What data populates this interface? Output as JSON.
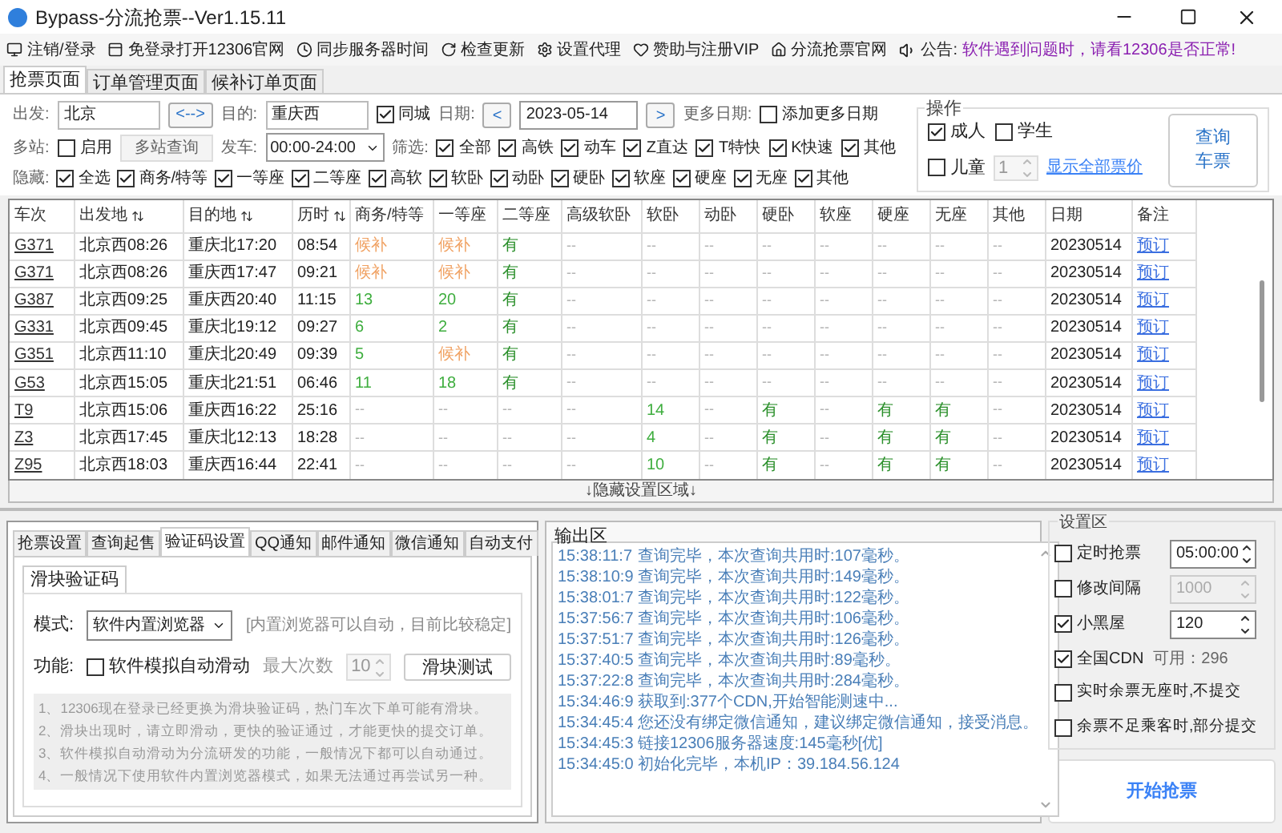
{
  "window": {
    "title": "Bypass-分流抢票--Ver1.15.11"
  },
  "toolbar": {
    "items": [
      "注销/登录",
      "免登录打开12306官网",
      "同步服务器时间",
      "检查更新",
      "设置代理",
      "赞助与注册VIP",
      "分流抢票官网"
    ],
    "notice_label": "公告:",
    "notice": "软件遇到问题时，请看12306是否正常!"
  },
  "tabs": [
    {
      "label": "抢票页面",
      "selected": true
    },
    {
      "label": "订单管理页面",
      "selected": false
    },
    {
      "label": "候补订单页面",
      "selected": false
    }
  ],
  "search": {
    "from_label": "出发:",
    "from": "北京",
    "swap": "<-->",
    "to_label": "目的:",
    "to": "重庆西",
    "same_city": {
      "label": "同城",
      "checked": true
    },
    "date_label": "日期:",
    "prev": "<",
    "date": "2023-05-14",
    "next": ">",
    "more_dates_label": "更多日期:",
    "add_more": {
      "label": "添加更多日期",
      "checked": false
    },
    "multi_label": "多站:",
    "multi_enable": {
      "label": "启用",
      "checked": false
    },
    "multi_button": "多站查询",
    "depart_label": "发车:",
    "depart": "00:00-24:00",
    "filter_label": "筛选:",
    "filters": [
      {
        "label": "全部",
        "checked": true
      },
      {
        "label": "高铁",
        "checked": true
      },
      {
        "label": "动车",
        "checked": true
      },
      {
        "label": "Z直达",
        "checked": true
      },
      {
        "label": "T特快",
        "checked": true
      },
      {
        "label": "K快速",
        "checked": true
      },
      {
        "label": "其他",
        "checked": true
      }
    ],
    "hide_label": "隐藏:",
    "hides": [
      {
        "label": "全选",
        "checked": true
      },
      {
        "label": "商务/特等",
        "checked": true
      },
      {
        "label": "一等座",
        "checked": true
      },
      {
        "label": "二等座",
        "checked": true
      },
      {
        "label": "高软",
        "checked": true
      },
      {
        "label": "软卧",
        "checked": true
      },
      {
        "label": "动卧",
        "checked": true
      },
      {
        "label": "硬卧",
        "checked": true
      },
      {
        "label": "软座",
        "checked": true
      },
      {
        "label": "硬座",
        "checked": true
      },
      {
        "label": "无座",
        "checked": true
      },
      {
        "label": "其他",
        "checked": true
      }
    ]
  },
  "operations": {
    "title": "操作",
    "passengers": [
      {
        "label": "成人",
        "checked": true
      },
      {
        "label": "学生",
        "checked": false
      },
      {
        "label": "儿童",
        "checked": false
      }
    ],
    "child_count": "1",
    "show_prices": "显示全部票价",
    "query_button": "查询车票"
  },
  "table": {
    "columns": [
      {
        "label": "车次",
        "sortable": false
      },
      {
        "label": "出发地",
        "sortable": true
      },
      {
        "label": "目的地",
        "sortable": true
      },
      {
        "label": "历时",
        "sortable": true
      },
      {
        "label": "商务/特等",
        "sortable": false
      },
      {
        "label": "一等座",
        "sortable": false
      },
      {
        "label": "二等座",
        "sortable": false
      },
      {
        "label": "高级软卧",
        "sortable": false
      },
      {
        "label": "软卧",
        "sortable": false
      },
      {
        "label": "动卧",
        "sortable": false
      },
      {
        "label": "硬卧",
        "sortable": false
      },
      {
        "label": "软座",
        "sortable": false
      },
      {
        "label": "硬座",
        "sortable": false
      },
      {
        "label": "无座",
        "sortable": false
      },
      {
        "label": "其他",
        "sortable": false
      },
      {
        "label": "日期",
        "sortable": false
      },
      {
        "label": "备注",
        "sortable": false
      }
    ],
    "rows": [
      {
        "train": "G371",
        "from": "北京西08:26",
        "to": "重庆北17:20",
        "duration": "08:54",
        "seats": [
          {
            "text": "候补",
            "kind": "wait"
          },
          {
            "text": "候补",
            "kind": "wait"
          },
          {
            "text": "有",
            "kind": "have"
          },
          {
            "text": "--",
            "kind": "none"
          },
          {
            "text": "--",
            "kind": "none"
          },
          {
            "text": "--",
            "kind": "none"
          },
          {
            "text": "--",
            "kind": "none"
          },
          {
            "text": "--",
            "kind": "none"
          },
          {
            "text": "--",
            "kind": "none"
          },
          {
            "text": "--",
            "kind": "none"
          },
          {
            "text": "--",
            "kind": "none"
          }
        ],
        "date": "20230514",
        "action": "预订"
      },
      {
        "train": "G371",
        "from": "北京西08:26",
        "to": "重庆西17:47",
        "duration": "09:21",
        "seats": [
          {
            "text": "候补",
            "kind": "wait"
          },
          {
            "text": "候补",
            "kind": "wait"
          },
          {
            "text": "有",
            "kind": "have"
          },
          {
            "text": "--",
            "kind": "none"
          },
          {
            "text": "--",
            "kind": "none"
          },
          {
            "text": "--",
            "kind": "none"
          },
          {
            "text": "--",
            "kind": "none"
          },
          {
            "text": "--",
            "kind": "none"
          },
          {
            "text": "--",
            "kind": "none"
          },
          {
            "text": "--",
            "kind": "none"
          },
          {
            "text": "--",
            "kind": "none"
          }
        ],
        "date": "20230514",
        "action": "预订"
      },
      {
        "train": "G387",
        "from": "北京西09:25",
        "to": "重庆西20:40",
        "duration": "11:15",
        "seats": [
          {
            "text": "13",
            "kind": "count"
          },
          {
            "text": "20",
            "kind": "count"
          },
          {
            "text": "有",
            "kind": "have"
          },
          {
            "text": "--",
            "kind": "none"
          },
          {
            "text": "--",
            "kind": "none"
          },
          {
            "text": "--",
            "kind": "none"
          },
          {
            "text": "--",
            "kind": "none"
          },
          {
            "text": "--",
            "kind": "none"
          },
          {
            "text": "--",
            "kind": "none"
          },
          {
            "text": "--",
            "kind": "none"
          },
          {
            "text": "--",
            "kind": "none"
          }
        ],
        "date": "20230514",
        "action": "预订"
      },
      {
        "train": "G331",
        "from": "北京西09:45",
        "to": "重庆北19:12",
        "duration": "09:27",
        "seats": [
          {
            "text": "6",
            "kind": "count"
          },
          {
            "text": "2",
            "kind": "count"
          },
          {
            "text": "有",
            "kind": "have"
          },
          {
            "text": "--",
            "kind": "none"
          },
          {
            "text": "--",
            "kind": "none"
          },
          {
            "text": "--",
            "kind": "none"
          },
          {
            "text": "--",
            "kind": "none"
          },
          {
            "text": "--",
            "kind": "none"
          },
          {
            "text": "--",
            "kind": "none"
          },
          {
            "text": "--",
            "kind": "none"
          },
          {
            "text": "--",
            "kind": "none"
          }
        ],
        "date": "20230514",
        "action": "预订"
      },
      {
        "train": "G351",
        "from": "北京西11:10",
        "to": "重庆北20:49",
        "duration": "09:39",
        "seats": [
          {
            "text": "5",
            "kind": "count"
          },
          {
            "text": "候补",
            "kind": "wait"
          },
          {
            "text": "有",
            "kind": "have"
          },
          {
            "text": "--",
            "kind": "none"
          },
          {
            "text": "--",
            "kind": "none"
          },
          {
            "text": "--",
            "kind": "none"
          },
          {
            "text": "--",
            "kind": "none"
          },
          {
            "text": "--",
            "kind": "none"
          },
          {
            "text": "--",
            "kind": "none"
          },
          {
            "text": "--",
            "kind": "none"
          },
          {
            "text": "--",
            "kind": "none"
          }
        ],
        "date": "20230514",
        "action": "预订"
      },
      {
        "train": "G53",
        "from": "北京西15:05",
        "to": "重庆北21:51",
        "duration": "06:46",
        "seats": [
          {
            "text": "11",
            "kind": "count"
          },
          {
            "text": "18",
            "kind": "count"
          },
          {
            "text": "有",
            "kind": "have"
          },
          {
            "text": "--",
            "kind": "none"
          },
          {
            "text": "--",
            "kind": "none"
          },
          {
            "text": "--",
            "kind": "none"
          },
          {
            "text": "--",
            "kind": "none"
          },
          {
            "text": "--",
            "kind": "none"
          },
          {
            "text": "--",
            "kind": "none"
          },
          {
            "text": "--",
            "kind": "none"
          },
          {
            "text": "--",
            "kind": "none"
          }
        ],
        "date": "20230514",
        "action": "预订"
      },
      {
        "train": "T9",
        "from": "北京西15:06",
        "to": "重庆西16:22",
        "duration": "25:16",
        "seats": [
          {
            "text": "--",
            "kind": "none"
          },
          {
            "text": "--",
            "kind": "none"
          },
          {
            "text": "--",
            "kind": "none"
          },
          {
            "text": "--",
            "kind": "none"
          },
          {
            "text": "14",
            "kind": "count"
          },
          {
            "text": "--",
            "kind": "none"
          },
          {
            "text": "有",
            "kind": "have"
          },
          {
            "text": "--",
            "kind": "none"
          },
          {
            "text": "有",
            "kind": "have"
          },
          {
            "text": "有",
            "kind": "have"
          },
          {
            "text": "--",
            "kind": "none"
          }
        ],
        "date": "20230514",
        "action": "预订"
      },
      {
        "train": "Z3",
        "from": "北京西17:45",
        "to": "重庆北12:13",
        "duration": "18:28",
        "seats": [
          {
            "text": "--",
            "kind": "none"
          },
          {
            "text": "--",
            "kind": "none"
          },
          {
            "text": "--",
            "kind": "none"
          },
          {
            "text": "--",
            "kind": "none"
          },
          {
            "text": "4",
            "kind": "count"
          },
          {
            "text": "--",
            "kind": "none"
          },
          {
            "text": "有",
            "kind": "have"
          },
          {
            "text": "--",
            "kind": "none"
          },
          {
            "text": "有",
            "kind": "have"
          },
          {
            "text": "有",
            "kind": "have"
          },
          {
            "text": "--",
            "kind": "none"
          }
        ],
        "date": "20230514",
        "action": "预订"
      },
      {
        "train": "Z95",
        "from": "北京西18:03",
        "to": "重庆西16:44",
        "duration": "22:41",
        "seats": [
          {
            "text": "--",
            "kind": "none"
          },
          {
            "text": "--",
            "kind": "none"
          },
          {
            "text": "--",
            "kind": "none"
          },
          {
            "text": "--",
            "kind": "none"
          },
          {
            "text": "10",
            "kind": "count"
          },
          {
            "text": "--",
            "kind": "none"
          },
          {
            "text": "有",
            "kind": "have"
          },
          {
            "text": "--",
            "kind": "none"
          },
          {
            "text": "有",
            "kind": "have"
          },
          {
            "text": "有",
            "kind": "have"
          },
          {
            "text": "--",
            "kind": "none"
          }
        ],
        "date": "20230514",
        "action": "预订"
      }
    ]
  },
  "hide_bar": "↓隐藏设置区域↓",
  "bottom_tabs": [
    {
      "label": "抢票设置",
      "selected": false
    },
    {
      "label": "查询起售",
      "selected": false
    },
    {
      "label": "验证码设置",
      "selected": true
    },
    {
      "label": "QQ通知",
      "selected": false
    },
    {
      "label": "邮件通知",
      "selected": false
    },
    {
      "label": "微信通知",
      "selected": false
    },
    {
      "label": "自动支付",
      "selected": false
    }
  ],
  "captcha": {
    "subtab": "滑块验证码",
    "mode_label": "模式:",
    "mode": "软件内置浏览器",
    "mode_hint": "[内置浏览器可以自动，目前比较稳定]",
    "func_label": "功能:",
    "auto_slide": {
      "label": "软件模拟自动滑动",
      "checked": false
    },
    "max_label": "最大次数",
    "max": "10",
    "test_button": "滑块测试",
    "notes": [
      "1、12306现在登录已经更换为滑块验证码，热门车次下单可能有滑块。",
      "2、滑块出现时，请立即滑动，更快的验证通过，才能更快的提交订单。",
      "3、软件模拟自动滑动为分流研发的功能，一般情况下都可以自动通过。",
      "4、一般情况下使用软件内置浏览器模式，如果无法通过再尝试另一种。"
    ]
  },
  "output": {
    "title": "输出区",
    "lines": [
      {
        "time": "15:38:11:7",
        "text": "查询完毕，本次查询共用时:107毫秒。"
      },
      {
        "time": "15:38:10:9",
        "text": "查询完毕，本次查询共用时:149毫秒。"
      },
      {
        "time": "15:38:01:7",
        "text": "查询完毕，本次查询共用时:122毫秒。"
      },
      {
        "time": "15:37:56:7",
        "text": "查询完毕，本次查询共用时:106毫秒。"
      },
      {
        "time": "15:37:51:7",
        "text": "查询完毕，本次查询共用时:126毫秒。"
      },
      {
        "time": "15:37:40:5",
        "text": "查询完毕，本次查询共用时:89毫秒。"
      },
      {
        "time": "15:37:22:8",
        "text": "查询完毕，本次查询共用时:284毫秒。"
      },
      {
        "time": "15:34:46:9",
        "text": "获取到:377个CDN,开始智能测速中..."
      },
      {
        "time": "15:34:45:4",
        "text": "您还没有绑定微信通知，建议绑定微信通知，接受消息。"
      },
      {
        "time": "15:34:45:3",
        "text": "链接12306服务器速度:145毫秒[优]"
      },
      {
        "time": "15:34:45:0",
        "text": "初始化完毕，本机IP：39.184.56.124"
      }
    ]
  },
  "settings": {
    "title": "设置区",
    "items": [
      {
        "kind": "spin",
        "label": "定时抢票",
        "checked": false,
        "value": "05:00:00",
        "disabled": false
      },
      {
        "kind": "spin",
        "label": "修改间隔",
        "checked": false,
        "value": "1000",
        "disabled": true
      },
      {
        "kind": "spin",
        "label": "小黑屋",
        "checked": true,
        "value": "120",
        "disabled": false
      },
      {
        "kind": "info",
        "label": "全国CDN",
        "checked": true,
        "info": "可用：296"
      },
      {
        "kind": "plain",
        "label": "实时余票无座时,不提交",
        "checked": false
      },
      {
        "kind": "plain",
        "label": "余票不足乘客时,部分提交",
        "checked": false
      }
    ],
    "start_button": "开始抢票"
  }
}
